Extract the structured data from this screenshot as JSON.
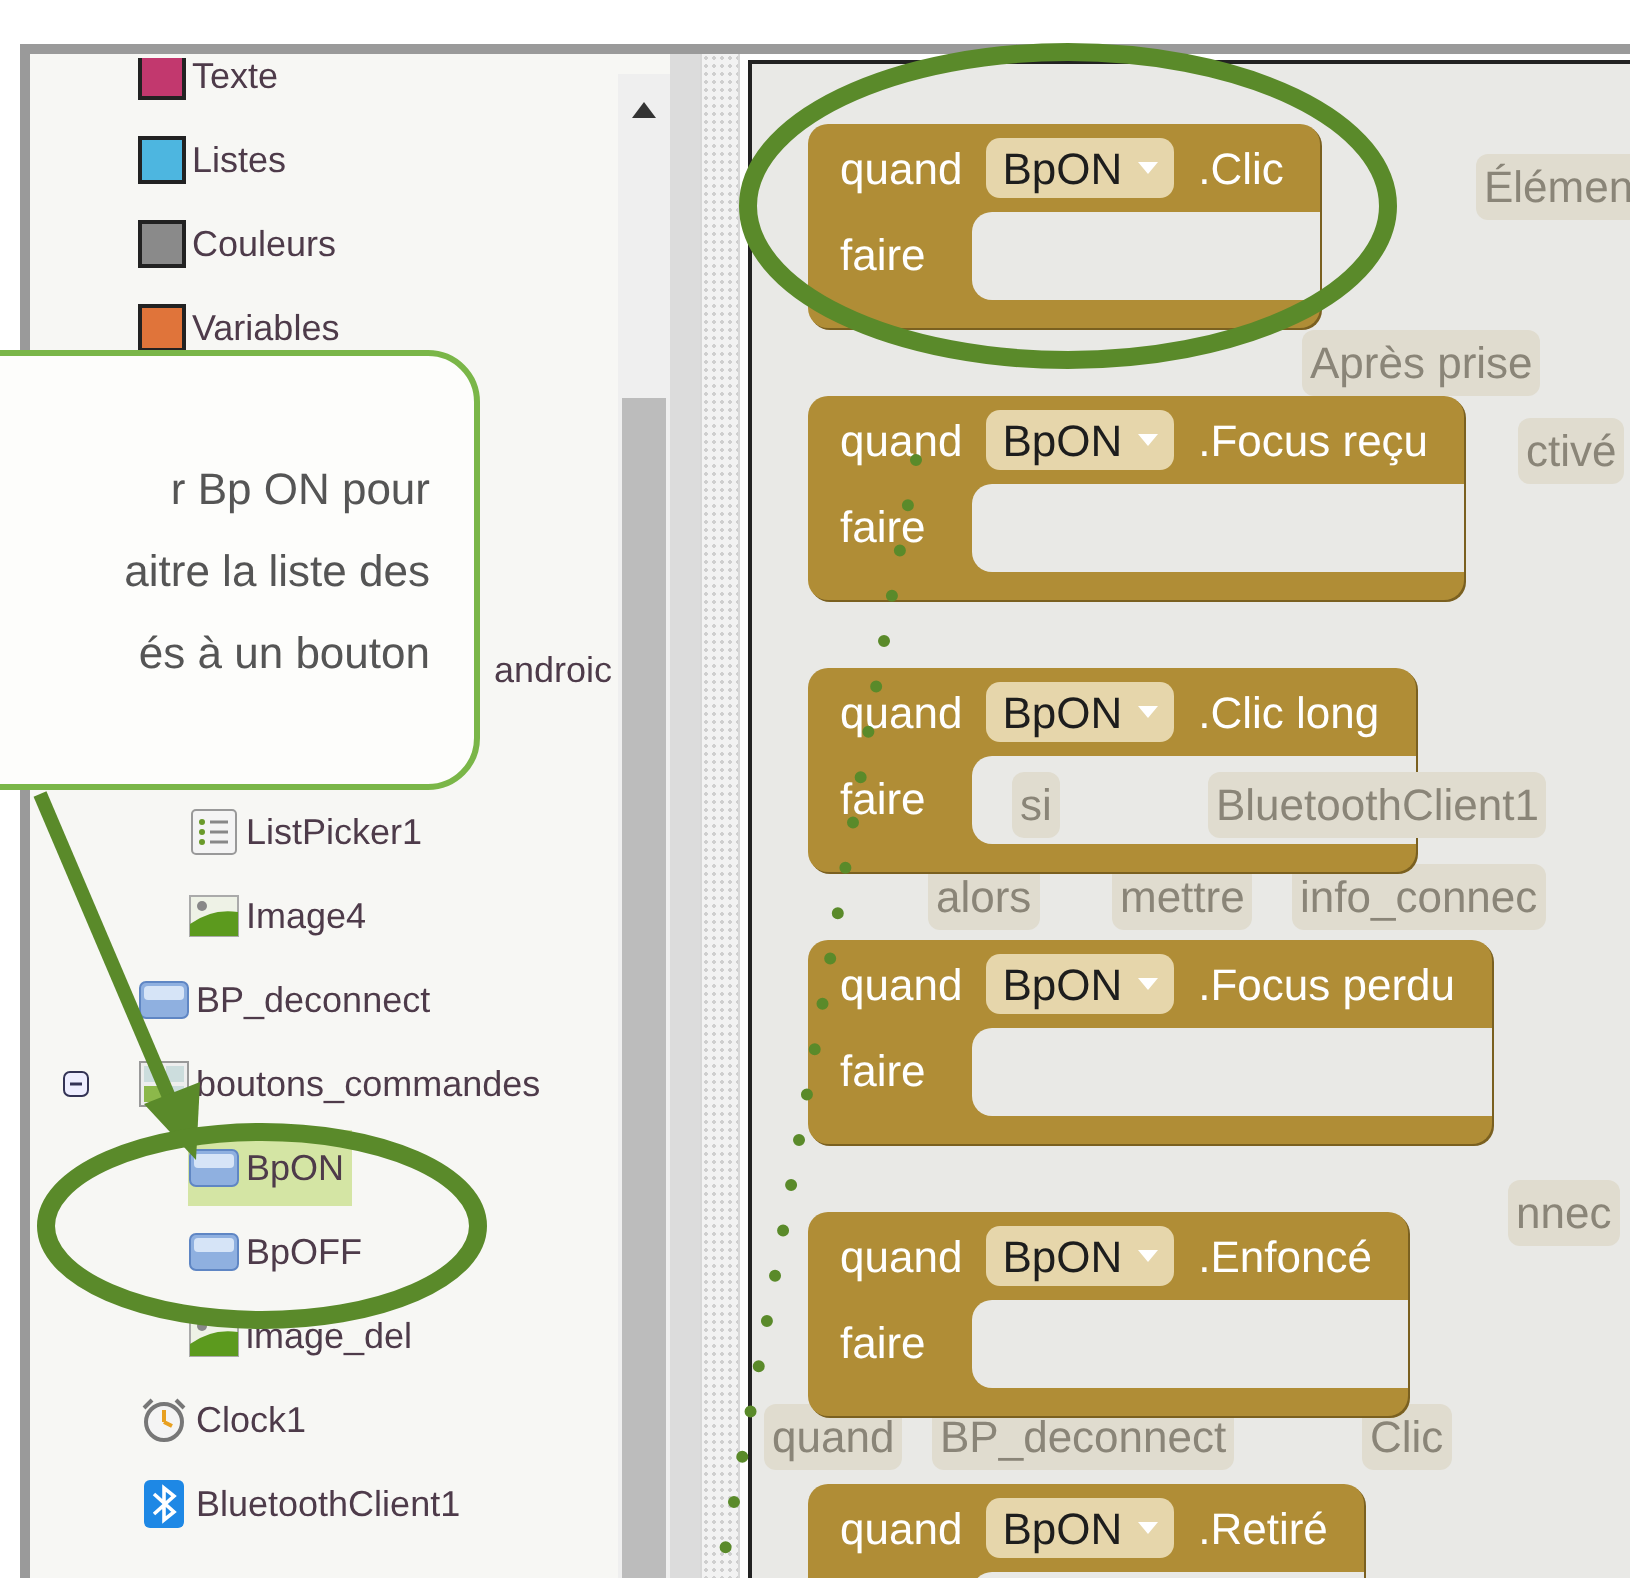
{
  "palette": {
    "categories": [
      {
        "label": "Texte",
        "color": "#c2386e"
      },
      {
        "label": "Listes",
        "color": "#4db6e0"
      },
      {
        "label": "Couleurs",
        "color": "#8a8a8a"
      },
      {
        "label": "Variables",
        "color": "#e0743a"
      }
    ]
  },
  "components": [
    {
      "children": [
        {
          "children": [
            {
              "label": "androic",
              "covered": true,
              "selected": false
            },
            {
              "label": "ListPicker1",
              "kind": "listpicker",
              "selected": false
            },
            {
              "label": "Image4",
              "kind": "image",
              "selected": false
            }
          ]
        },
        {
          "label": "BP_deconnect",
          "kind": "button",
          "selected": false
        },
        {
          "label": "boutons_commandes",
          "kind": "table",
          "selected": false,
          "expanded": true,
          "children": [
            {
              "label": "BpON",
              "kind": "button",
              "selected": true
            },
            {
              "label": "BpOFF",
              "kind": "button",
              "selected": false
            },
            {
              "label": "image_del",
              "kind": "image",
              "selected": false
            }
          ]
        },
        {
          "label": "Clock1",
          "kind": "clock",
          "selected": false
        },
        {
          "label": "BluetoothClient1",
          "kind": "bluetooth",
          "selected": false
        }
      ]
    }
  ],
  "callout": {
    "lines": [
      "r  Bp ON pour",
      "aitre la liste des",
      "és à un bouton"
    ]
  },
  "background_blocks": [
    "Élémen",
    "Après prise",
    "ctivé",
    "si",
    "BluetoothClient1",
    "alors",
    "mettre",
    "info_connec",
    "nnec",
    "quand",
    "BP_deconnect",
    "Clic"
  ],
  "event_blocks": [
    {
      "keyword": "quand",
      "component": "BpON",
      "event": ".Clic",
      "body": "faire"
    },
    {
      "keyword": "quand",
      "component": "BpON",
      "event": ".Focus reçu",
      "body": "faire"
    },
    {
      "keyword": "quand",
      "component": "BpON",
      "event": ".Clic long",
      "body": "faire"
    },
    {
      "keyword": "quand",
      "component": "BpON",
      "event": ".Focus perdu",
      "body": "faire"
    },
    {
      "keyword": "quand",
      "component": "BpON",
      "event": ".Enfoncé",
      "body": "faire"
    },
    {
      "keyword": "quand",
      "component": "BpON",
      "event": ".Retiré"
    }
  ]
}
